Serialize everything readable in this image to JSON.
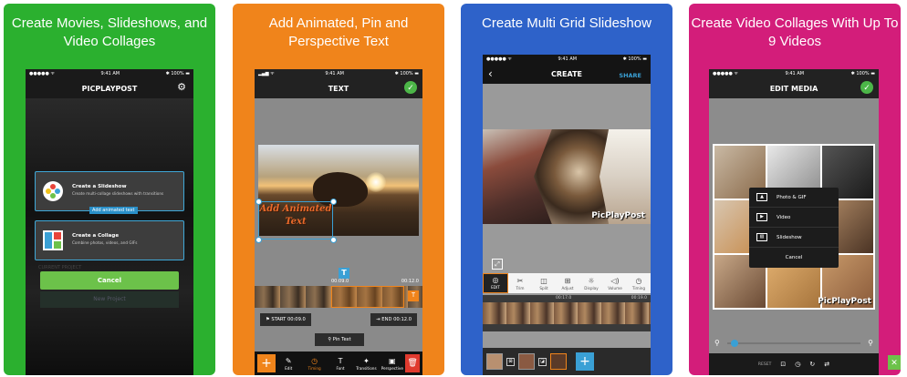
{
  "panels": [
    {
      "title": "Create Movies, Slideshows, and Video Collages",
      "bg": "#2bb02f",
      "status": {
        "carrier": "●●●●● ᯤ",
        "time": "9:41 AM",
        "battery": "✱ 100% ▬"
      },
      "nav_title": "PICPLAYPOST",
      "cards": [
        {
          "title": "Create a Slideshow",
          "subtitle": "Create multi-collage slideshows with transitions"
        },
        {
          "title": "Create a Collage",
          "subtitle": "Combine photos, videos, and GIFs"
        }
      ],
      "tag": "Add animated text",
      "current_project": "CURRENT PROJECT",
      "cancel": "Cancel",
      "new_project": "New Project"
    },
    {
      "title": "Add Animated, Pin and Perspective Text",
      "bg": "#f0841b",
      "status": {
        "carrier": "▂▄▆ ᯤ",
        "time": "9:41 AM",
        "battery": "✱ 100% ▬"
      },
      "nav_title": "TEXT",
      "overlay_text": "Add Animated Text",
      "time_left": "00:09.0",
      "time_right": "00:12.0",
      "start_label": "START 00:09.0",
      "end_label": "END 00:12.0",
      "pin_label": "Pin Text",
      "toolbar": [
        "Edit",
        "Timing",
        "Font",
        "Transitions",
        "Perspective"
      ],
      "active_tool": "Timing"
    },
    {
      "title": "Create Multi Grid Slideshow",
      "bg": "#2e62c9",
      "status": {
        "carrier": "●●●●● ᯤ",
        "time": "9:41 AM",
        "battery": "✱ 100% ▬"
      },
      "nav_title": "CREATE",
      "share": "SHARE",
      "watermark": "PicPlayPost",
      "tools": [
        "EDIT",
        "Trim",
        "Split",
        "Adjust",
        "Display",
        "Volume",
        "Timing"
      ],
      "timeline_left": "00:17.0",
      "timeline_right": "00:19.0"
    },
    {
      "title": "Create Video Collages With Up To 9 Videos",
      "bg": "#d31d7a",
      "status": {
        "carrier": "●●●●● ᯤ",
        "time": "9:41 AM",
        "battery": "✱ 100% ▬"
      },
      "nav_title": "EDIT MEDIA",
      "menu": [
        "Photo & GIF",
        "Video",
        "Slideshow"
      ],
      "menu_cancel": "Cancel",
      "watermark": "PicPlayPost",
      "reset": "RESET"
    }
  ]
}
